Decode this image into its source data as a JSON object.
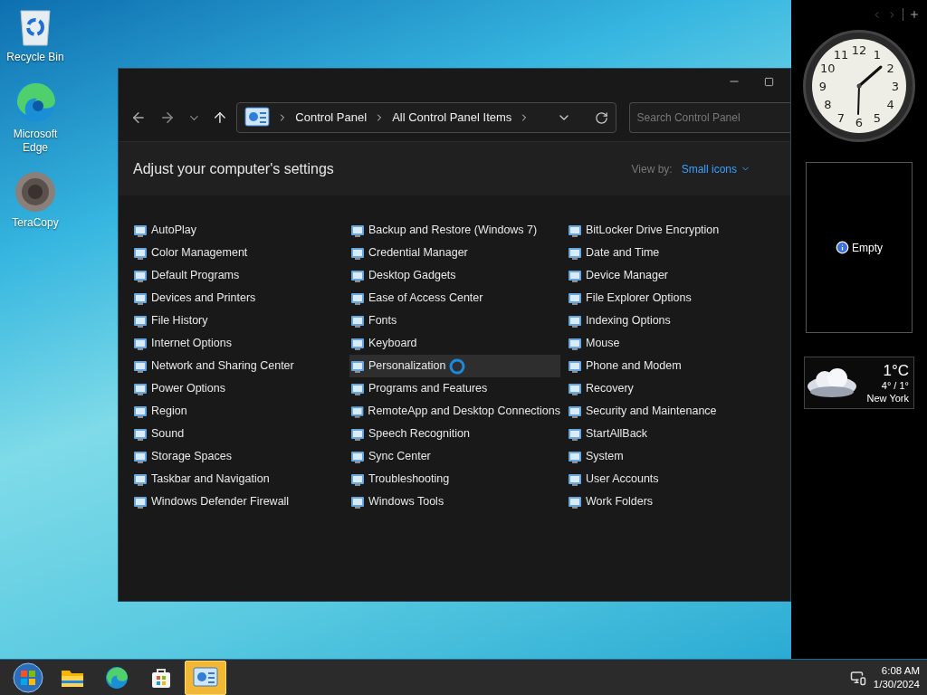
{
  "desktop_icons": [
    {
      "kind": "recycle-bin",
      "label": "Recycle Bin"
    },
    {
      "kind": "edge",
      "label": "Microsoft Edge"
    },
    {
      "kind": "teracopy",
      "label": "TeraCopy"
    }
  ],
  "window": {
    "address": [
      "Control Panel",
      "All Control Panel Items"
    ],
    "search": {
      "placeholder": "Search Control Panel"
    },
    "heading": "Adjust your computer's settings",
    "view_by": {
      "label": "View by:",
      "value": "Small icons"
    },
    "columns": [
      [
        {
          "label": "AutoPlay",
          "selected": false
        },
        {
          "label": "Color Management",
          "selected": false
        },
        {
          "label": "Default Programs",
          "selected": false
        },
        {
          "label": "Devices and Printers",
          "selected": false
        },
        {
          "label": "File History",
          "selected": false
        },
        {
          "label": "Internet Options",
          "selected": false
        },
        {
          "label": "Network and Sharing Center",
          "selected": false
        },
        {
          "label": "Power Options",
          "selected": false
        },
        {
          "label": "Region",
          "selected": false
        },
        {
          "label": "Sound",
          "selected": false
        },
        {
          "label": "Storage Spaces",
          "selected": false
        },
        {
          "label": "Taskbar and Navigation",
          "selected": false
        },
        {
          "label": "Windows Defender Firewall",
          "selected": false
        }
      ],
      [
        {
          "label": "Backup and Restore (Windows 7)",
          "selected": false
        },
        {
          "label": "Credential Manager",
          "selected": false
        },
        {
          "label": "Desktop Gadgets",
          "selected": false
        },
        {
          "label": "Ease of Access Center",
          "selected": false
        },
        {
          "label": "Fonts",
          "selected": false
        },
        {
          "label": "Keyboard",
          "selected": false
        },
        {
          "label": "Personalization",
          "selected": true
        },
        {
          "label": "Programs and Features",
          "selected": false
        },
        {
          "label": "RemoteApp and Desktop Connections",
          "selected": false
        },
        {
          "label": "Speech Recognition",
          "selected": false
        },
        {
          "label": "Sync Center",
          "selected": false
        },
        {
          "label": "Troubleshooting",
          "selected": false
        },
        {
          "label": "Windows Tools",
          "selected": false
        }
      ],
      [
        {
          "label": "BitLocker Drive Encryption",
          "selected": false
        },
        {
          "label": "Date and Time",
          "selected": false
        },
        {
          "label": "Device Manager",
          "selected": false
        },
        {
          "label": "File Explorer Options",
          "selected": false
        },
        {
          "label": "Indexing Options",
          "selected": false
        },
        {
          "label": "Mouse",
          "selected": false
        },
        {
          "label": "Phone and Modem",
          "selected": false
        },
        {
          "label": "Recovery",
          "selected": false
        },
        {
          "label": "Security and Maintenance",
          "selected": false
        },
        {
          "label": "StartAllBack",
          "selected": false
        },
        {
          "label": "System",
          "selected": false
        },
        {
          "label": "User Accounts",
          "selected": false
        },
        {
          "label": "Work Folders",
          "selected": false
        }
      ]
    ]
  },
  "sidebar": {
    "clock": {
      "numerals": [
        "12",
        "11",
        "1",
        "10",
        "2",
        "9",
        "3",
        "8",
        "4",
        "7",
        "5",
        "6"
      ]
    },
    "slideshow": {
      "text": "Empty"
    },
    "weather": {
      "temperature": "1°C",
      "range": "4° / 1°",
      "city": "New York"
    }
  },
  "taskbar": {
    "apps": [
      {
        "kind": "start",
        "selected": false
      },
      {
        "kind": "explorer",
        "selected": false
      },
      {
        "kind": "edge",
        "selected": false
      },
      {
        "kind": "store",
        "selected": false
      },
      {
        "kind": "control-panel",
        "selected": true
      }
    ],
    "time": "6:08 AM",
    "date": "1/30/2024"
  }
}
